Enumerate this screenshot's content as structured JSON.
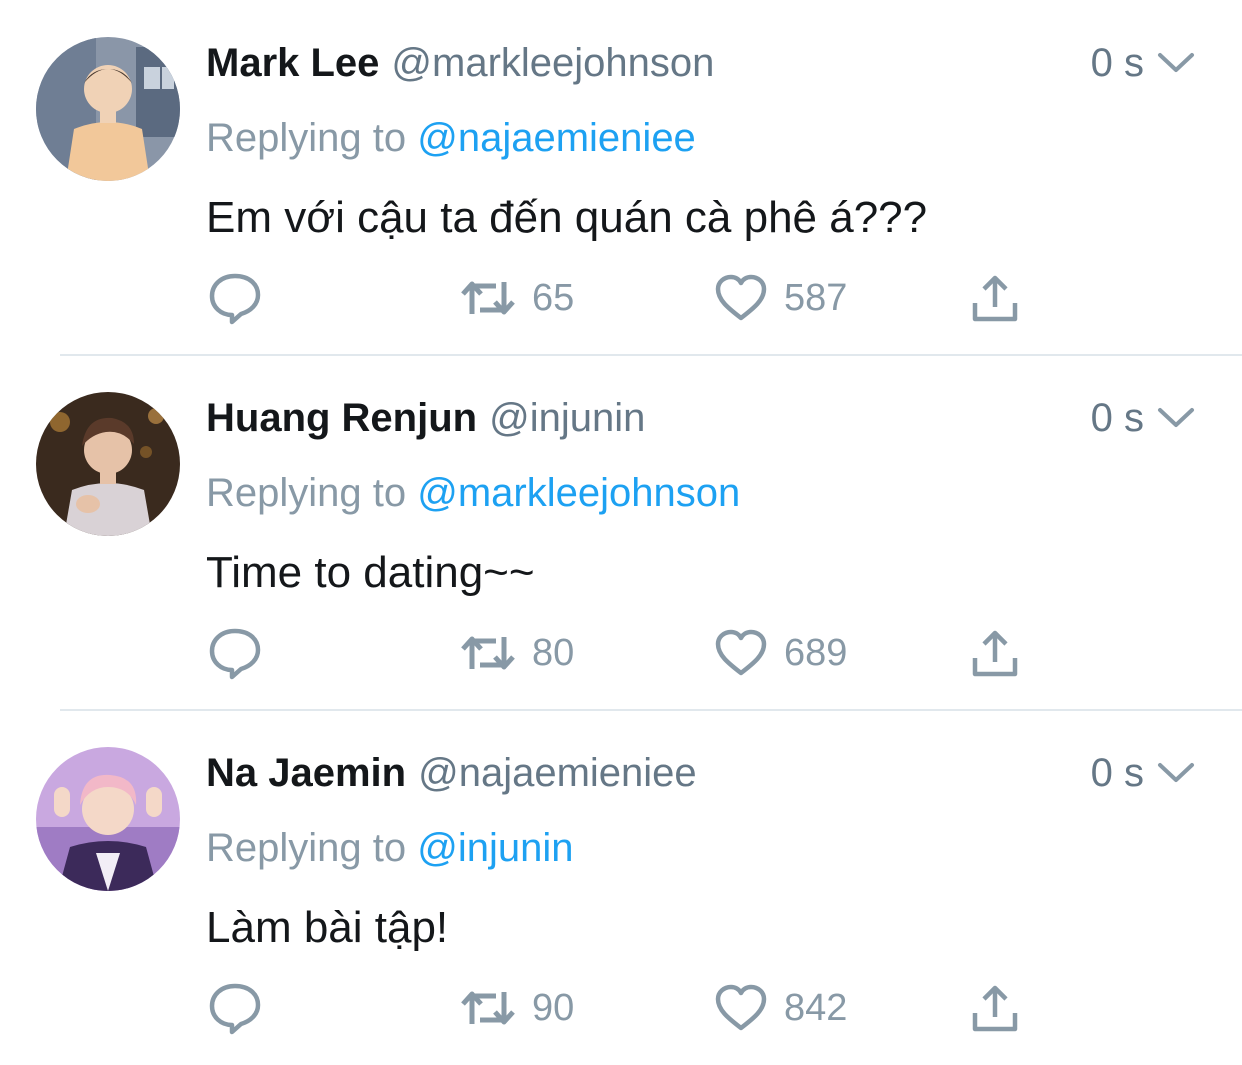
{
  "colors": {
    "accent": "#1da1f2",
    "muted_text": "#657786",
    "action_icon": "#8899a6",
    "divider": "#e1e8ed"
  },
  "tweets": [
    {
      "name": "Mark Lee",
      "handle": "@markleejohnson",
      "time": "0 s",
      "replying_prefix": "Replying to",
      "replying_to": "@najaemieniee",
      "text": "Em với cậu ta đến quán cà phê á???",
      "retweets": "65",
      "likes": "587",
      "avatar_icon": "avatar-photo"
    },
    {
      "name": "Huang Renjun",
      "handle": "@injunin",
      "time": "0 s",
      "replying_prefix": "Replying to",
      "replying_to": "@markleejohnson",
      "text": "Time to dating~~",
      "retweets": "80",
      "likes": "689",
      "avatar_icon": "avatar-photo"
    },
    {
      "name": "Na Jaemin",
      "handle": "@najaemieniee",
      "time": "0 s",
      "replying_prefix": "Replying to",
      "replying_to": "@injunin",
      "text": "Làm bài tập!",
      "retweets": "90",
      "likes": "842",
      "avatar_icon": "avatar-photo"
    }
  ]
}
